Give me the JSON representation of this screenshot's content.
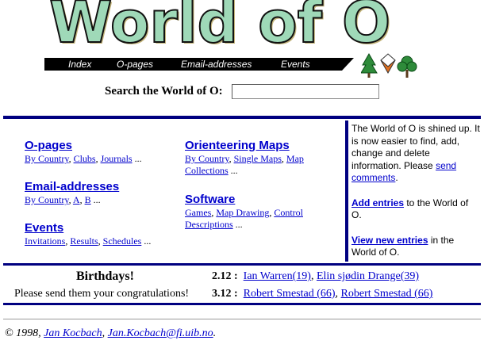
{
  "logo": {
    "text": "World of O"
  },
  "nav": {
    "items": [
      {
        "label": "Index"
      },
      {
        "label": "O-pages"
      },
      {
        "label": "Email-addresses"
      },
      {
        "label": "Events"
      }
    ]
  },
  "search": {
    "label": "Search the World of O:",
    "value": ""
  },
  "categories": {
    "opages": {
      "title": "O-pages",
      "links": [
        "By Country",
        "Clubs",
        "Journals"
      ],
      "more": "..."
    },
    "email": {
      "title": "Email-addresses",
      "links": [
        "By Country",
        "A",
        "B"
      ],
      "more": "..."
    },
    "events": {
      "title": "Events",
      "links": [
        "Invitations",
        "Results",
        "Schedules"
      ],
      "more": "..."
    },
    "maps": {
      "title": "Orienteering Maps",
      "links": [
        "By Country",
        "Single Maps",
        "Map Collections"
      ],
      "more": "..."
    },
    "software": {
      "title": "Software",
      "links": [
        "Games",
        "Map Drawing",
        "Control Descriptions"
      ],
      "more": "..."
    }
  },
  "info": {
    "p1_text": "The World of O is shined up. It is now easier to find, add, change and delete information. Please ",
    "p1_link": "send comments",
    "p1_end": ".",
    "p2_link": "Add entries",
    "p2_text": " to the World of O.",
    "p3_link": "View new entries",
    "p3_text": " in the World of O."
  },
  "birthdays": {
    "title": "Birthdays!",
    "message": "Please send them your congratulations!",
    "rows": [
      {
        "date": "2.12 :",
        "names": [
          "Ian Warren(19)",
          "Elin sjødin Drange(39)"
        ]
      },
      {
        "date": "3.12 :",
        "names": [
          "Robert Smestad (66)",
          "Robert Smestad (66)"
        ]
      }
    ]
  },
  "footer": {
    "copyright": "© 1998,",
    "author": "Jan Kocbach",
    "email": "Jan.Kocbach@fi.uib.no",
    "end": "."
  }
}
